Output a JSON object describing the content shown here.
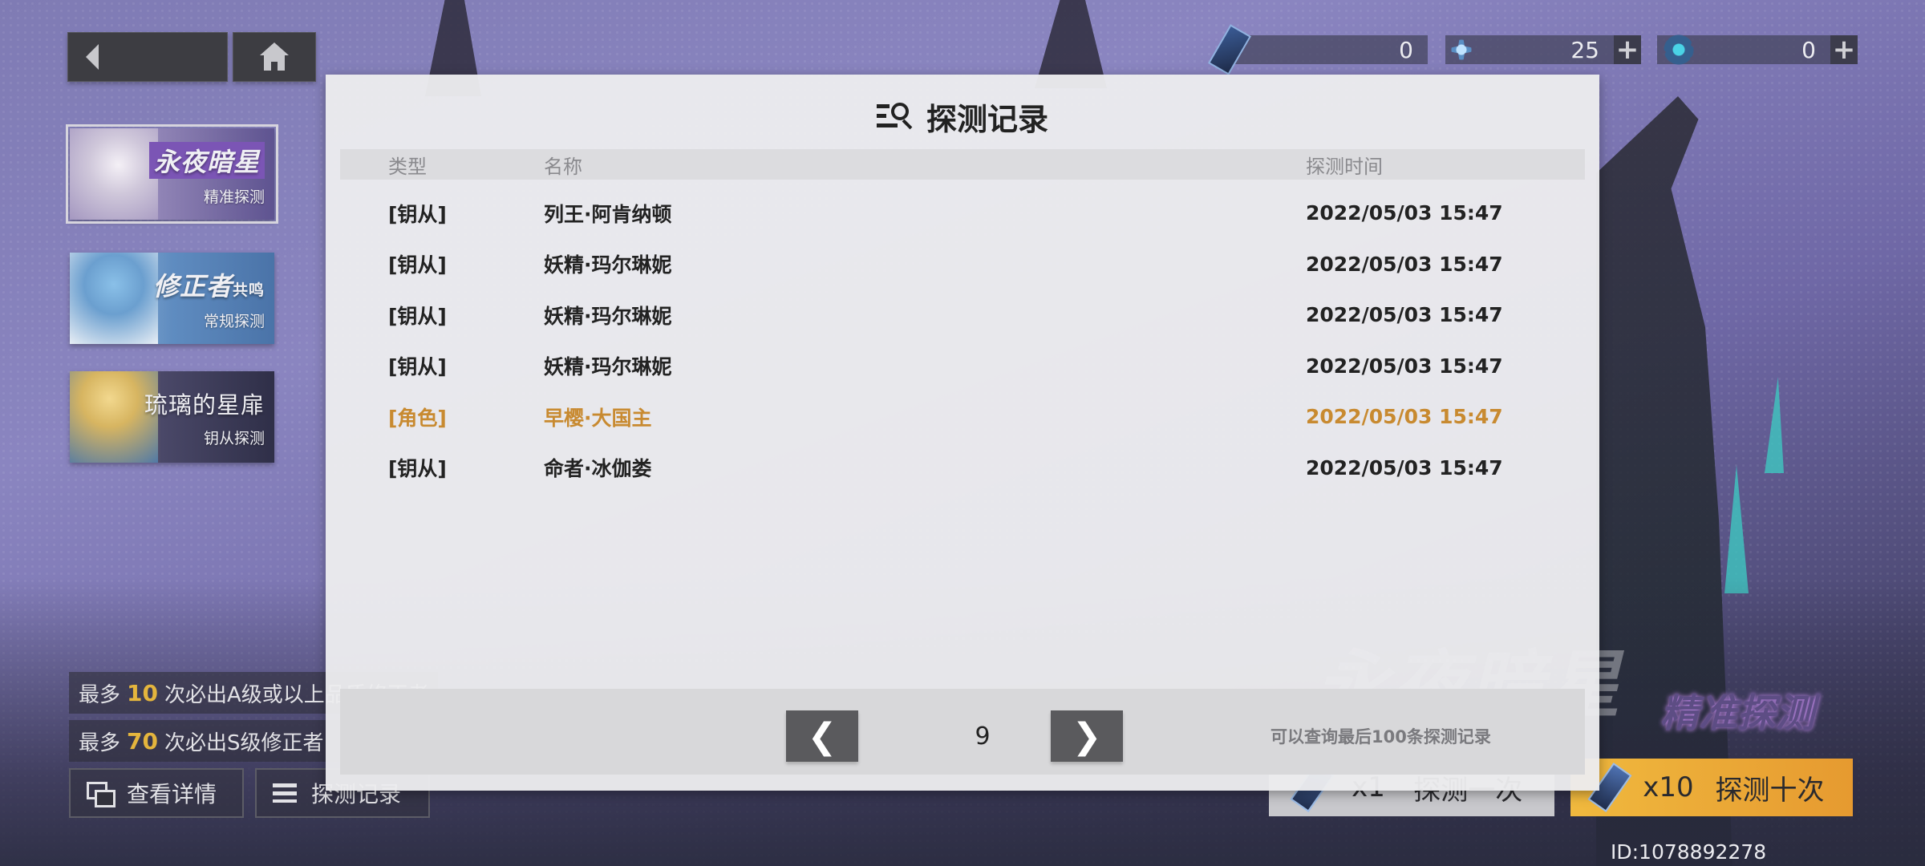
{
  "nav": {
    "back_icon": "chevron-left-icon",
    "home_icon": "home-icon"
  },
  "currencies": [
    {
      "icon": "ticket-icon",
      "value": "0",
      "has_plus": false
    },
    {
      "icon": "star-shard-icon",
      "value": "25",
      "has_plus": true,
      "plus": "+"
    },
    {
      "icon": "crystal-icon",
      "value": "0",
      "has_plus": true,
      "plus": "+"
    }
  ],
  "banners": [
    {
      "title": "永夜暗星",
      "subtitle": "精准探测",
      "selected": true
    },
    {
      "title": "修正者",
      "title_suffix": "共鸣",
      "subtitle": "常规探测",
      "selected": false
    },
    {
      "title": "琉璃的星扉",
      "subtitle": "钥从探测",
      "selected": false
    }
  ],
  "guarantee": [
    {
      "prefix": "最多",
      "count": "10",
      "suffix": "次必出A级或以上品质修正者"
    },
    {
      "prefix": "最多",
      "count": "70",
      "suffix": "次必出S级修正者"
    }
  ],
  "bottom_buttons": {
    "details": "查看详情",
    "records": "探测记录"
  },
  "draw": {
    "once_qty": "x1",
    "once_label": "探测一次",
    "ten_qty": "x10",
    "ten_label": "探测十次"
  },
  "banner_display": {
    "title": "永夜暗星",
    "subtitle": "精准探测"
  },
  "user_id": "ID:1078892278",
  "modal": {
    "title": "探测记录",
    "title_icon": "search-list-icon",
    "columns": {
      "type": "类型",
      "name": "名称",
      "time": "探测时间"
    },
    "rows": [
      {
        "type": "[钥从]",
        "name": "列王·阿肯纳顿",
        "time": "2022/05/03 15:47",
        "highlight": false
      },
      {
        "type": "[钥从]",
        "name": "妖精·玛尔琳妮",
        "time": "2022/05/03 15:47",
        "highlight": false
      },
      {
        "type": "[钥从]",
        "name": "妖精·玛尔琳妮",
        "time": "2022/05/03 15:47",
        "highlight": false
      },
      {
        "type": "[钥从]",
        "name": "妖精·玛尔琳妮",
        "time": "2022/05/03 15:47",
        "highlight": false
      },
      {
        "type": "[角色]",
        "name": "早樱·大国主",
        "time": "2022/05/03 15:47",
        "highlight": true
      },
      {
        "type": "[钥从]",
        "name": "命者·冰伽娄",
        "time": "2022/05/03 15:47",
        "highlight": false
      }
    ],
    "highlight_color": "#c88a30",
    "pager": {
      "prev": "❮",
      "next": "❯",
      "page": "9",
      "note": "可以查询最后100条探测记录"
    }
  }
}
